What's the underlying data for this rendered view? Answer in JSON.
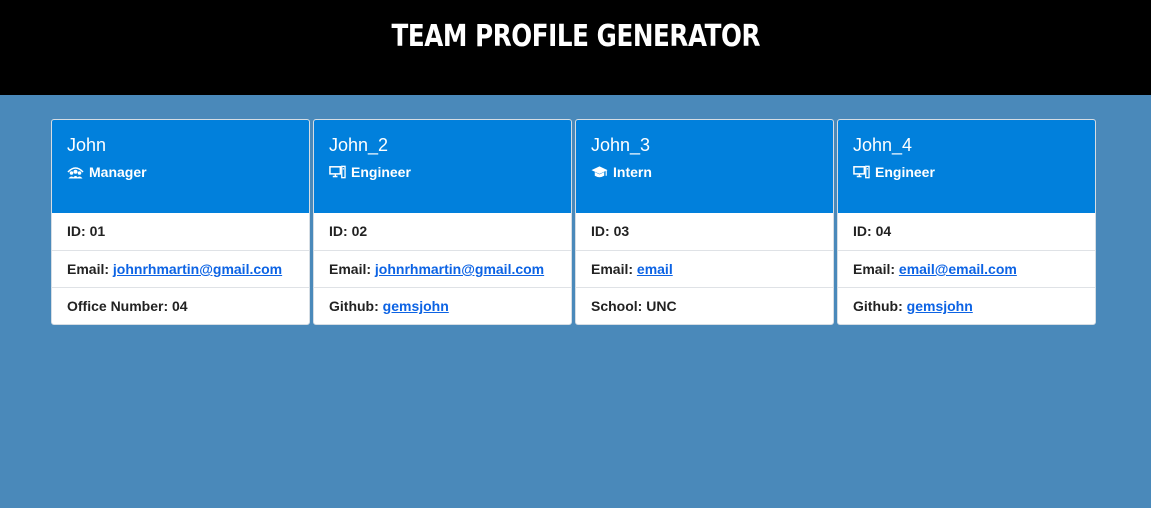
{
  "page": {
    "title": "Team Profile Generator",
    "colors": {
      "background": "#4a89ba",
      "header": "#000000",
      "card_header": "#0180dc",
      "link": "#0c63e4"
    }
  },
  "cards": [
    {
      "name": "John",
      "role": "Manager",
      "role_icon": "manager-icon",
      "id_label": "ID:",
      "id": "01",
      "email_label": "Email:",
      "email": "johnrhmartin@gmail.com",
      "extra_label": "Office Number:",
      "extra": "04"
    },
    {
      "name": "John_2",
      "role": "Engineer",
      "role_icon": "computer-icon",
      "id_label": "ID:",
      "id": "02",
      "email_label": "Email:",
      "email": "johnrhmartin@gmail.com",
      "extra_label": "Github:",
      "extra": "gemsjohn"
    },
    {
      "name": "John_3",
      "role": "Intern",
      "role_icon": "graduation-cap-icon",
      "id_label": "ID:",
      "id": "03",
      "email_label": "Email:",
      "email": "email",
      "extra_label": "School:",
      "extra": "UNC"
    },
    {
      "name": "John_4",
      "role": "Engineer",
      "role_icon": "computer-icon",
      "id_label": "ID:",
      "id": "04",
      "email_label": "Email:",
      "email": "email@email.com",
      "extra_label": "Github:",
      "extra": "gemsjohn"
    }
  ]
}
